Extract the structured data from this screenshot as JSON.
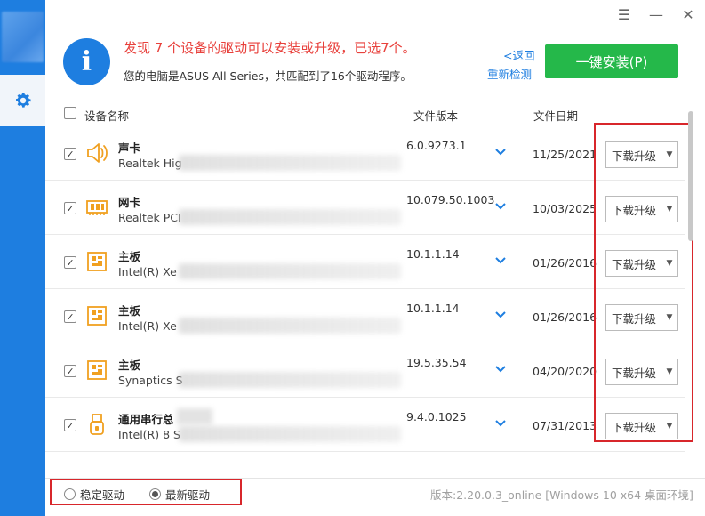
{
  "window": {
    "controls": [
      "menu-icon",
      "minimize-icon",
      "close-icon"
    ]
  },
  "sidebar": {
    "items": [
      {
        "icon": "gear-icon",
        "active": true
      }
    ]
  },
  "header": {
    "icon": "info-icon",
    "icon_glyph": "i",
    "headline": "发现 7 个设备的驱动可以安装或升级，已选7个。",
    "subline": "您的电脑是ASUS All Series，共匹配到了16个驱动程序。",
    "back_link": "<返回",
    "rescan_link": "重新检测",
    "install_button": "一键安装(P)"
  },
  "table": {
    "columns": {
      "name": "设备名称",
      "version": "文件版本",
      "date": "文件日期"
    },
    "rows": [
      {
        "title": "声卡",
        "desc": "Realtek Hig",
        "version": "6.0.9273.1",
        "date": "11/25/2021",
        "action": "下载升级",
        "icon": "speaker-icon",
        "checked": true
      },
      {
        "title": "网卡",
        "desc": "Realtek PCI",
        "version": "10.079.50.1003",
        "date": "10/03/2025",
        "action": "下载升级",
        "icon": "network-card-icon",
        "checked": true
      },
      {
        "title": "主板",
        "desc": "Intel(R) Xe",
        "version": "10.1.1.14",
        "date": "01/26/2016",
        "action": "下载升级",
        "icon": "motherboard-icon",
        "checked": true
      },
      {
        "title": "主板",
        "desc": "Intel(R) Xe",
        "version": "10.1.1.14",
        "date": "01/26/2016",
        "action": "下载升级",
        "icon": "motherboard-icon",
        "checked": true
      },
      {
        "title": "主板",
        "desc": "Synaptics S",
        "version": "19.5.35.54",
        "date": "04/20/2020",
        "action": "下载升级",
        "icon": "motherboard-icon",
        "checked": true
      },
      {
        "title": "通用串行总",
        "desc": "Intel(R) 8 S",
        "version": "9.4.0.1025",
        "date": "07/31/2013",
        "action": "下载升级",
        "icon": "usb-icon",
        "checked": true
      }
    ]
  },
  "footer": {
    "radio_stable": "稳定驱动",
    "radio_latest": "最新驱动",
    "selected": "latest",
    "version_info": "版本:2.20.0.3_online [Windows 10 x64 桌面环境]"
  },
  "colors": {
    "brand_blue": "#1e7ee0",
    "install_green": "#25b84a",
    "alert_red": "#e8413c",
    "icon_orange": "#f0a020",
    "highlight_red": "#d8262b"
  }
}
